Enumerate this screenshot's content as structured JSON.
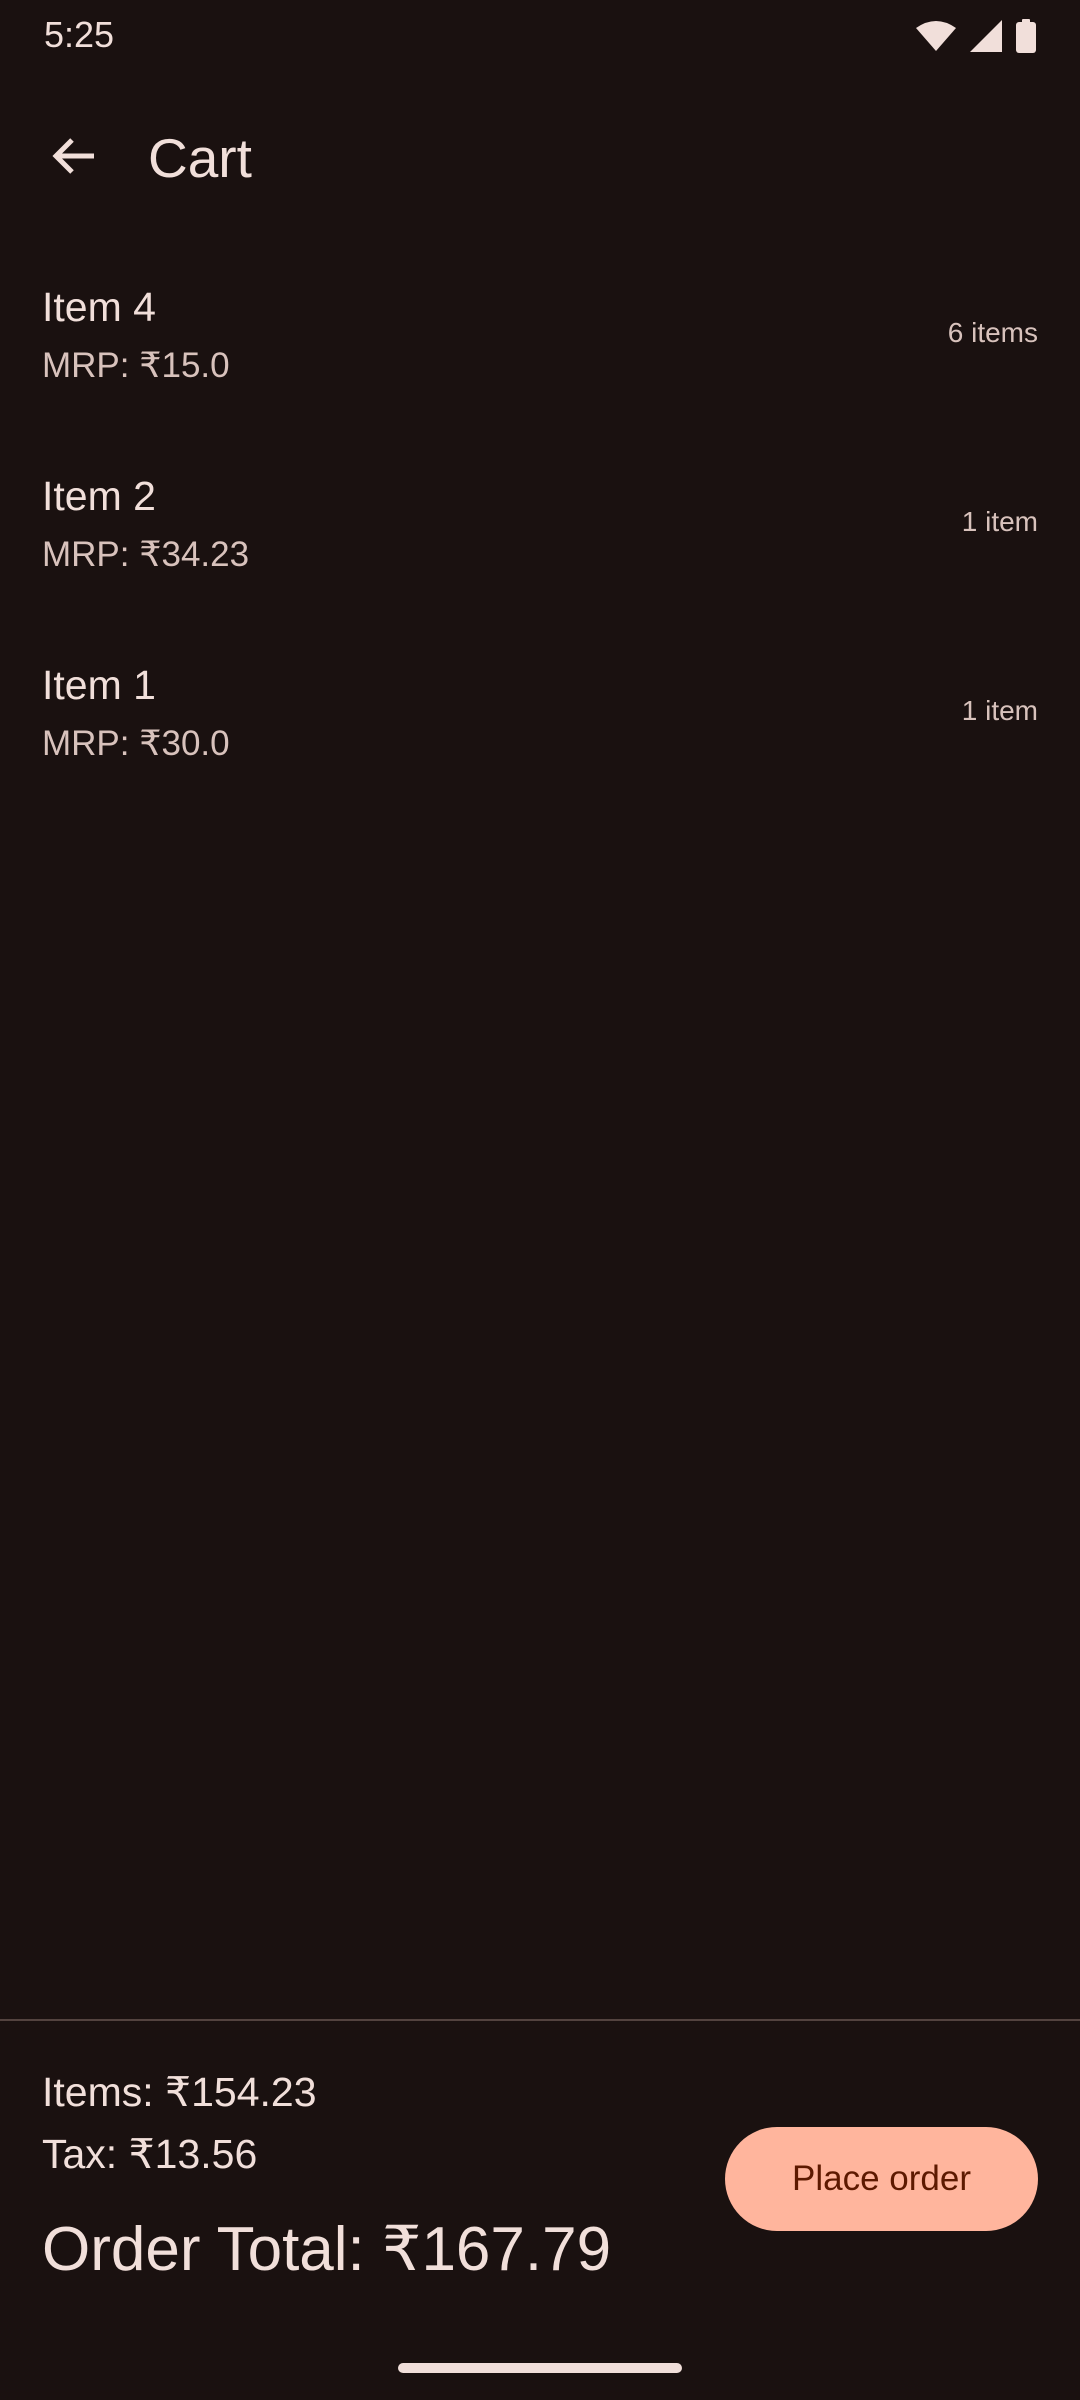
{
  "status_bar": {
    "time": "5:25",
    "icons": [
      "wifi-icon",
      "cell-signal-icon",
      "battery-icon"
    ]
  },
  "app_bar": {
    "back_icon": "arrow-back-icon",
    "title": "Cart"
  },
  "cart": {
    "items": [
      {
        "name": "Item 4",
        "mrp": "MRP: ₹15.0",
        "quantity": "6 items"
      },
      {
        "name": "Item 2",
        "mrp": "MRP: ₹34.23",
        "quantity": "1 item"
      },
      {
        "name": "Item 1",
        "mrp": "MRP: ₹30.0",
        "quantity": "1 item"
      }
    ]
  },
  "summary": {
    "items_total": "Items: ₹154.23",
    "tax": "Tax: ₹13.56",
    "order_total": "Order Total: ₹167.79",
    "place_order_label": "Place order"
  },
  "colors": {
    "background": "#1a1110",
    "text_primary": "#f1dfda",
    "text_secondary": "#d8c2bc",
    "accent_button": "#ffb59d",
    "accent_button_text": "#5d1900",
    "divider": "#53433f"
  }
}
